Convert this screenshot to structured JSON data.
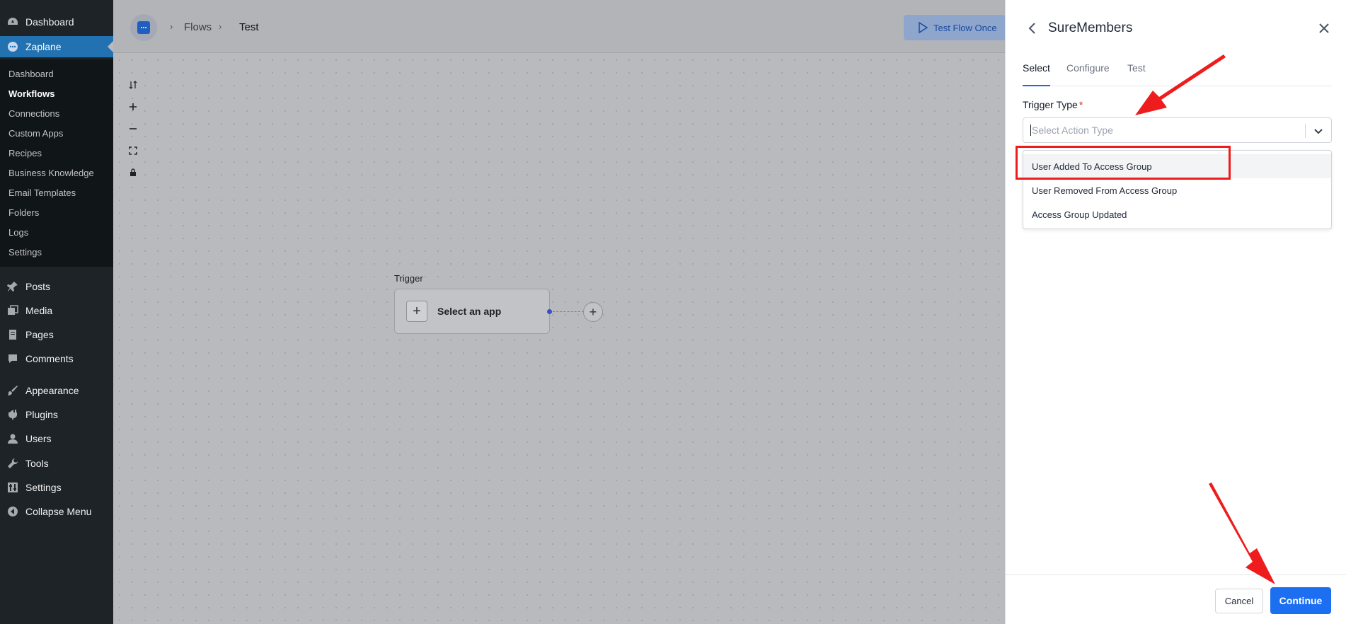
{
  "wp_menu": {
    "items": [
      {
        "label": "Dashboard",
        "icon": "dashboard-icon"
      },
      {
        "label": "Zaplane",
        "icon": "zaplane-icon"
      },
      {
        "label": "Posts",
        "icon": "pin-icon"
      },
      {
        "label": "Media",
        "icon": "media-icon"
      },
      {
        "label": "Pages",
        "icon": "pages-icon"
      },
      {
        "label": "Comments",
        "icon": "comment-icon"
      },
      {
        "label": "Appearance",
        "icon": "brush-icon"
      },
      {
        "label": "Plugins",
        "icon": "plugin-icon"
      },
      {
        "label": "Users",
        "icon": "user-icon"
      },
      {
        "label": "Tools",
        "icon": "wrench-icon"
      },
      {
        "label": "Settings",
        "icon": "settings-icon"
      },
      {
        "label": "Collapse Menu",
        "icon": "collapse-icon"
      }
    ],
    "submenu": [
      "Dashboard",
      "Workflows",
      "Connections",
      "Custom Apps",
      "Recipes",
      "Business Knowledge",
      "Email Templates",
      "Folders",
      "Logs",
      "Settings"
    ],
    "current_sub": "Workflows"
  },
  "topbar": {
    "breadcrumbs": [
      "Flows",
      "Test"
    ],
    "test_button": "Test Flow Once"
  },
  "canvas": {
    "trigger_label": "Trigger",
    "node_text": "Select an app"
  },
  "panel": {
    "title": "SureMembers",
    "tabs": [
      "Select",
      "Configure",
      "Test"
    ],
    "active_tab": "Select",
    "field_label": "Trigger Type",
    "required_mark": "*",
    "placeholder": "Select Action Type",
    "options": [
      "User Added To Access Group",
      "User Removed From Access Group",
      "Access Group Updated"
    ],
    "cancel": "Cancel",
    "continue": "Continue"
  },
  "colors": {
    "accent": "#1d6ff2",
    "annotation": "#ee1c1c"
  }
}
